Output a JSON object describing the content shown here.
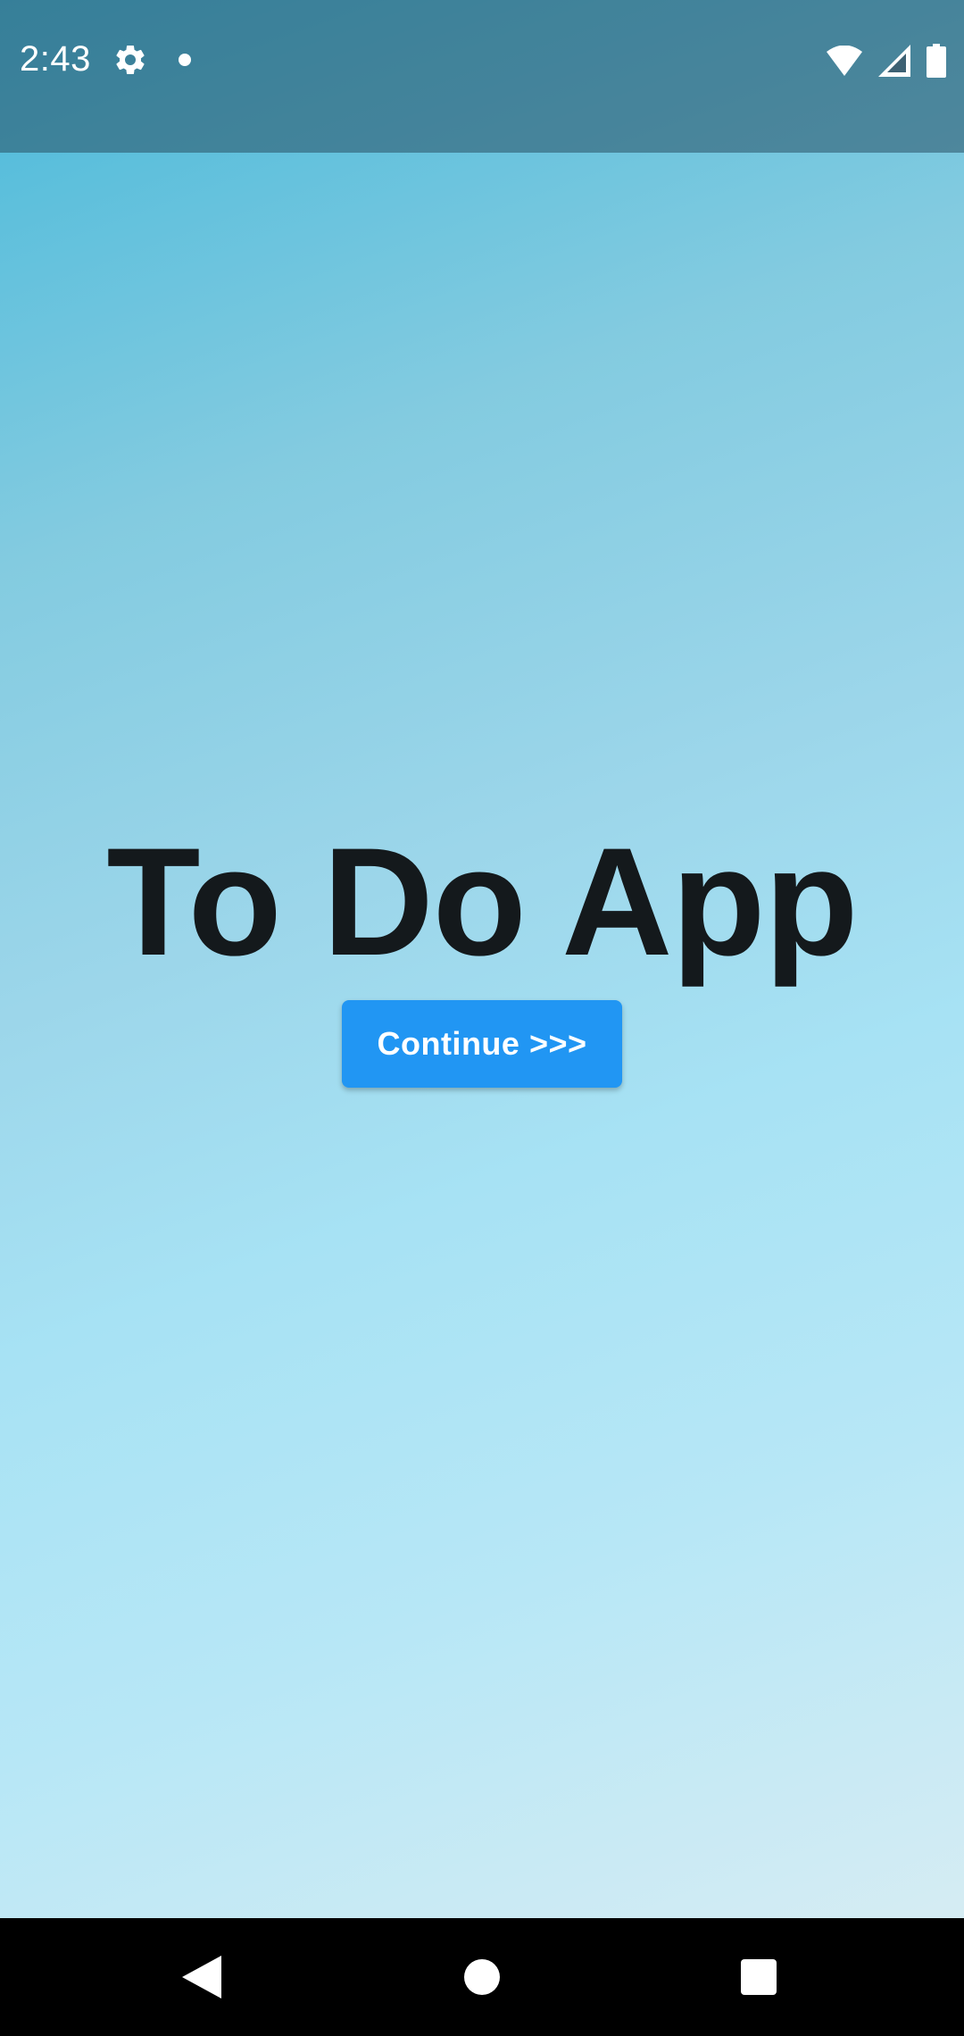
{
  "status_bar": {
    "time": "2:43",
    "icons": [
      "gear-icon",
      "notification-dot-icon",
      "wifi-icon",
      "signal-icon",
      "battery-icon"
    ]
  },
  "main": {
    "title": "To Do App",
    "continue_label": "Continue >>>"
  },
  "nav_bar": {
    "icons": [
      "back-icon",
      "home-icon",
      "recents-icon"
    ]
  },
  "colors": {
    "button": "#2196f3",
    "title_text": "#14191c",
    "background_top": "#48b9da",
    "background_bottom": "#d5ecf3"
  }
}
